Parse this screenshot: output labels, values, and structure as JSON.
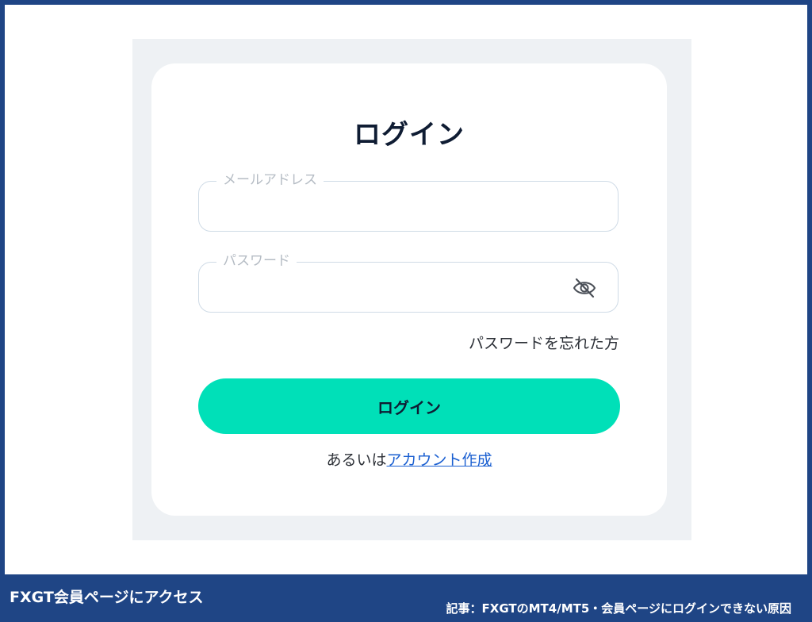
{
  "login": {
    "title": "ログイン",
    "email_label": "メールアドレス",
    "email_value": "",
    "password_label": "パスワード",
    "password_value": "",
    "forgot_password": "パスワードを忘れた方",
    "login_button": "ログイン",
    "signup_prefix": "あるいは",
    "signup_link": "アカウント作成"
  },
  "icons": {
    "password_toggle": "eye-off-icon"
  },
  "colors": {
    "frame": "#1f4585",
    "panel_background": "#eef1f4",
    "button": "#00e0b8",
    "link": "#1a5fd1"
  },
  "caption": {
    "left": "FXGT会員ページにアクセス",
    "right": "記事：FXGTのMT4/MT5・会員ページにログインできない原因"
  }
}
